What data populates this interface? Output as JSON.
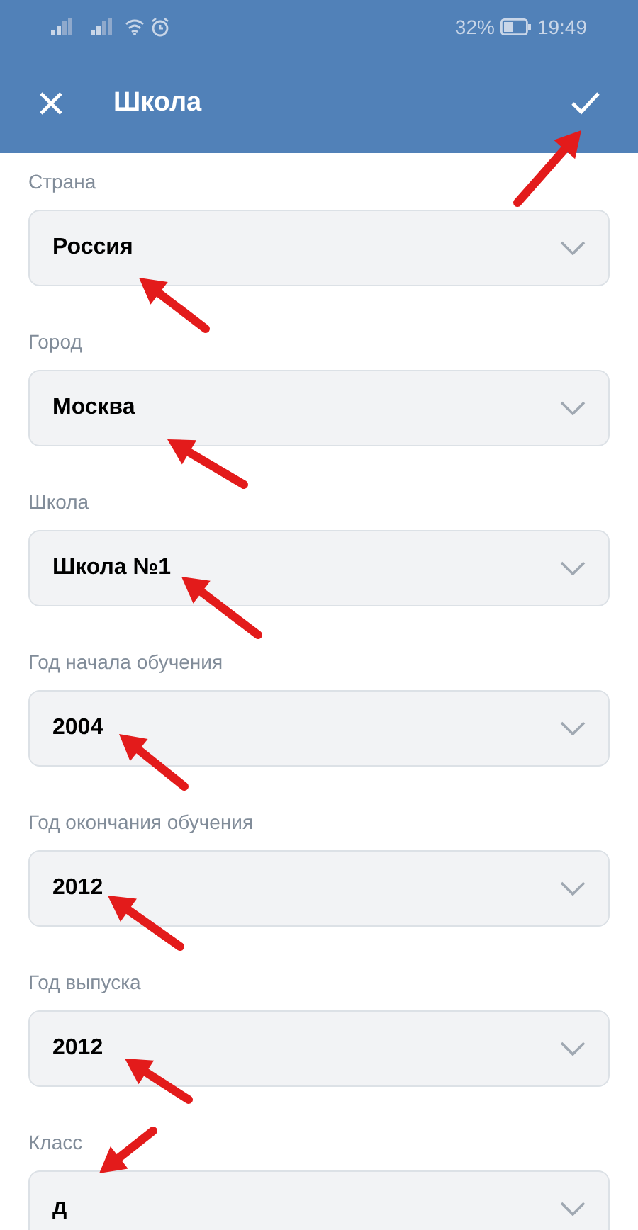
{
  "status_bar": {
    "battery_percent": "32%",
    "time": "19:49"
  },
  "toolbar": {
    "title": "Школа"
  },
  "fields": [
    {
      "label": "Страна",
      "value": "Россия"
    },
    {
      "label": "Город",
      "value": "Москва"
    },
    {
      "label": "Школа",
      "value": "Школа №1"
    },
    {
      "label": "Год начала обучения",
      "value": "2004"
    },
    {
      "label": "Год окончания обучения",
      "value": "2012"
    },
    {
      "label": "Год выпуска",
      "value": "2012"
    },
    {
      "label": "Класс",
      "value": "д"
    }
  ]
}
